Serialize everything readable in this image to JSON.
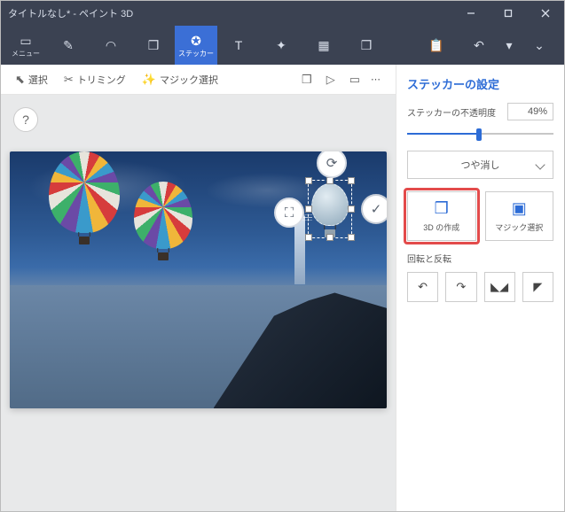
{
  "window": {
    "title": "タイトルなし* - ペイント 3D"
  },
  "tabs": {
    "menu": "メニュー",
    "sticker": "ステッカー"
  },
  "subtoolbar": {
    "select": "選択",
    "trimming": "トリミング",
    "magic_select": "マジック選択"
  },
  "canvas": {
    "help": "?"
  },
  "sidebar": {
    "title": "ステッカーの設定",
    "opacity_label": "ステッカーの不透明度",
    "opacity_value": "49%",
    "opacity_percent": 49,
    "finish_label": "つや消し",
    "buttons": {
      "make3d": "3D の作成",
      "magic_select": "マジック選択"
    },
    "rotate_flip_label": "回転と反転"
  }
}
